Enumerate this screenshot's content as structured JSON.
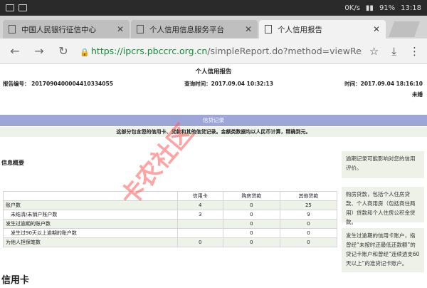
{
  "status": {
    "speed": "0K/s",
    "battery": "91%",
    "time": "13:18"
  },
  "tabs": [
    {
      "label": "中国人民银行征信中心"
    },
    {
      "label": "个人信用信息服务平台"
    },
    {
      "label": "个人信用报告"
    }
  ],
  "address": {
    "scheme": "https://ipcrs.pbccrc.org.cn",
    "rest": "/simpleReport.do?method=viewReport"
  },
  "report": {
    "title": "个人信用报告",
    "report_no": "报告编号： 2017090400004410334055",
    "query_time": "查询时间：2017.09.04 10:32:13",
    "report_time": "时间：2017.09.04 18:16:10",
    "unit": "未婚"
  },
  "banner": {
    "title": "信贷记录",
    "subtitle": "这部分包含您的信用卡、贷款和其他信贷记录。金额类数据均以人民币计算，精确到元。"
  },
  "overview": {
    "title": "信息概要"
  },
  "side_notes": [
    "逾期记录可能影响对您的信用评价。",
    "购房贷款，包括个人住房贷款、个人商用房（包括商住两用）贷款和个人住房公积金贷款。",
    "发生过逾期的信用卡账户，指曾经“未按时还最低还款额”的贷记卡账户和曾经“连续透支60天以上”的准贷记卡账户。"
  ],
  "summary": {
    "headers": [
      "",
      "信用卡",
      "购房贷款",
      "其他贷款"
    ],
    "rows": [
      [
        "账户数",
        "4",
        "0",
        "25"
      ],
      [
        "　未结清/未销户账户数",
        "3",
        "0",
        "9"
      ],
      [
        "发生过逾期的账户数",
        "",
        "0",
        "0"
      ],
      [
        "　发生过90天以上逾期的账户数",
        "",
        "0",
        "0"
      ],
      [
        "为他人担保笔数",
        "0",
        "0",
        "0"
      ]
    ]
  },
  "credit_card": {
    "heading": "信用卡"
  },
  "watermark": "卡农社区",
  "colors": {
    "banner": "#9da5d9",
    "watermark": "#ff5a5a",
    "secure": "#1a8a3a"
  }
}
